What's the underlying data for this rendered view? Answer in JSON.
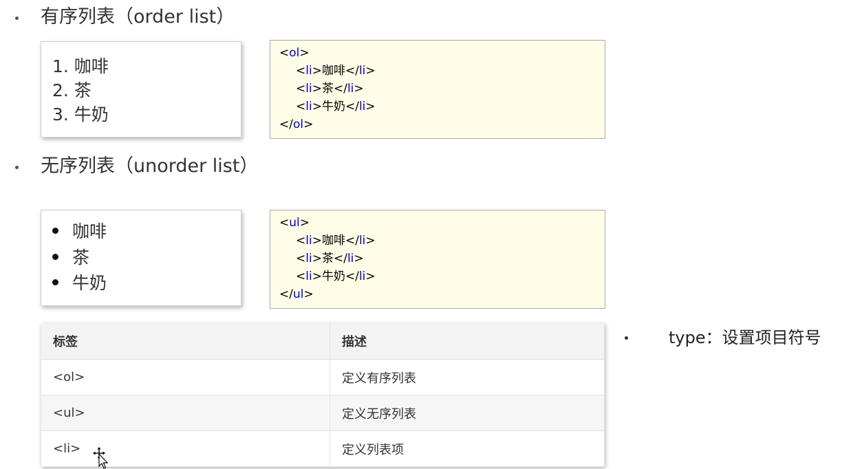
{
  "ordered_section": {
    "heading": "有序列表（order list）",
    "items": [
      "1. 咖啡",
      "2. 茶",
      "3. 牛奶"
    ],
    "code": {
      "open_tag": "ol",
      "item_tag": "li",
      "items": [
        "咖啡",
        "茶",
        "牛奶"
      ]
    }
  },
  "unordered_section": {
    "heading": "无序列表（unorder list）",
    "items": [
      "咖啡",
      "茶",
      "牛奶"
    ],
    "code": {
      "open_tag": "ul",
      "item_tag": "li",
      "items": [
        "咖啡",
        "茶",
        "牛奶"
      ]
    }
  },
  "reference_table": {
    "headers": [
      "标签",
      "描述"
    ],
    "rows": [
      [
        "<ol>",
        "定义有序列表"
      ],
      [
        "<ul>",
        "定义无序列表"
      ],
      [
        "<li>",
        "定义列表项"
      ]
    ]
  },
  "side_note": {
    "text": "type：设置项目符号"
  },
  "colors": {
    "code_background": "#fffde8",
    "tag_color": "#0000cc",
    "table_header_background": "#f3f3f3"
  },
  "icons": {
    "cursor": "move-cursor-icon"
  }
}
